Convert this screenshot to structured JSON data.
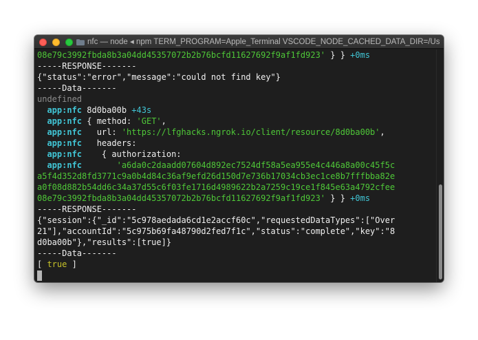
{
  "window": {
    "title": "nfc — node ◂ npm TERM_PROGRAM=Apple_Terminal VSCODE_NODE_CACHED_DATA_DIR=/User..."
  },
  "terminal": {
    "lines": [
      [
        {
          "t": "08e79c3992fbda8b3a04dd45357072b2b76bcfd11627692f9af1fd923'",
          "c": "green"
        },
        {
          "t": " } } ",
          "c": "white"
        },
        {
          "t": "+0ms",
          "c": "cyan"
        }
      ],
      [
        {
          "t": "-----RESPONSE-------",
          "c": "white"
        }
      ],
      [
        {
          "t": "{\"status\":\"error\",\"message\":\"could not find key\"}",
          "c": "white"
        }
      ],
      [
        {
          "t": "-----Data-------",
          "c": "white"
        }
      ],
      [
        {
          "t": "undefined",
          "c": "gray"
        }
      ],
      [
        {
          "t": "  ",
          "c": "white"
        },
        {
          "t": "app:nfc",
          "c": "cyan",
          "b": true
        },
        {
          "t": " 8d0ba00b ",
          "c": "white"
        },
        {
          "t": "+43s",
          "c": "cyan"
        }
      ],
      [
        {
          "t": "  ",
          "c": "white"
        },
        {
          "t": "app:nfc",
          "c": "cyan",
          "b": true
        },
        {
          "t": " { method: ",
          "c": "white"
        },
        {
          "t": "'GET'",
          "c": "green"
        },
        {
          "t": ",",
          "c": "white"
        }
      ],
      [
        {
          "t": "  ",
          "c": "white"
        },
        {
          "t": "app:nfc",
          "c": "cyan",
          "b": true
        },
        {
          "t": "   url: ",
          "c": "white"
        },
        {
          "t": "'https://lfghacks.ngrok.io/client/resource/8d0ba00b'",
          "c": "green"
        },
        {
          "t": ",",
          "c": "white"
        }
      ],
      [
        {
          "t": "  ",
          "c": "white"
        },
        {
          "t": "app:nfc",
          "c": "cyan",
          "b": true
        },
        {
          "t": "   headers:",
          "c": "white"
        }
      ],
      [
        {
          "t": "  ",
          "c": "white"
        },
        {
          "t": "app:nfc",
          "c": "cyan",
          "b": true
        },
        {
          "t": "    { authorization:",
          "c": "white"
        }
      ],
      [
        {
          "t": "  ",
          "c": "white"
        },
        {
          "t": "app:nfc",
          "c": "cyan",
          "b": true
        },
        {
          "t": "       'a6da0c2daadd07604d892ec7524df58a5ea955e4c446a8a00c45f5c",
          "c": "green"
        }
      ],
      [
        {
          "t": "a5f4d352d8fd3771c9a0b4d84c36af9efd26d150d7e736b17034cb3ec1ce8b7fffbba82e",
          "c": "green"
        }
      ],
      [
        {
          "t": "a0f08d882b54dd6c34a37d55c6f03fe1716d4989622b2a7259c19ce1f845e63a4792cfee",
          "c": "green"
        }
      ],
      [
        {
          "t": "08e79c3992fbda8b3a04dd45357072b2b76bcfd11627692f9af1fd923'",
          "c": "green"
        },
        {
          "t": " } } ",
          "c": "white"
        },
        {
          "t": "+0ms",
          "c": "cyan"
        }
      ],
      [
        {
          "t": "-----RESPONSE-------",
          "c": "white"
        }
      ],
      [
        {
          "t": "{\"session\":{\"_id\":\"5c978aedada6cd1e2accf60c\",\"requestedDataTypes\":[\"Over",
          "c": "white"
        }
      ],
      [
        {
          "t": "21\"],\"accountId\":\"5c975b69fa48790d2fed7f1c\",\"status\":\"complete\",\"key\":\"8",
          "c": "white"
        }
      ],
      [
        {
          "t": "d0ba00b\"},\"results\":[true]}",
          "c": "white"
        }
      ],
      [
        {
          "t": "-----Data-------",
          "c": "white"
        }
      ],
      [
        {
          "t": "[ ",
          "c": "white"
        },
        {
          "t": "true",
          "c": "yellow"
        },
        {
          "t": " ]",
          "c": "white"
        }
      ]
    ]
  },
  "colors": {
    "background": "#1e1e1e",
    "green": "#4fc838",
    "cyan": "#41c6d6",
    "gray": "#8e8e8e",
    "yellow": "#c7c329"
  },
  "icons": {
    "close": "close-icon",
    "minimize": "minimize-icon",
    "maximize": "maximize-icon",
    "folder": "folder-icon"
  }
}
